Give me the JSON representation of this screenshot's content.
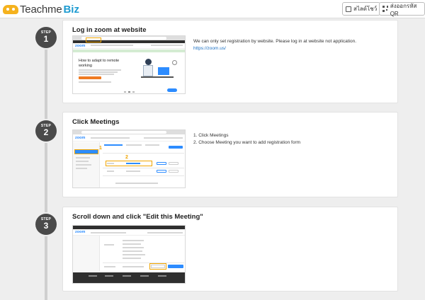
{
  "header": {
    "brand_text": "Teachme",
    "brand_suffix": "Biz",
    "slides_button": "สไลด์โชว์",
    "qr_button": "ส่งออกรหัส QR"
  },
  "steps": [
    {
      "badge_label": "STEP",
      "number": "1",
      "title": "Log in zoom at website",
      "text": "We can only set registration by website. Please log in  at website not application.",
      "link": "https://zoom.us/",
      "screenshot": {
        "banner_title": "How to adapt to remote working"
      }
    },
    {
      "badge_label": "STEP",
      "number": "2",
      "title": "Click Meetings",
      "list": [
        "1. Click Meetings",
        "2. Choose Meeting you want to add registration form"
      ],
      "screenshot": {
        "callout_1": "1",
        "callout_2": "2"
      }
    },
    {
      "badge_label": "STEP",
      "number": "3",
      "title": "Scroll down and click \"Edit this Meeting\""
    }
  ],
  "colors": {
    "zoom_blue": "#2d8cff",
    "highlight": "#f0a500",
    "badge": "#4a4a4a",
    "link": "#1a6fc2"
  }
}
